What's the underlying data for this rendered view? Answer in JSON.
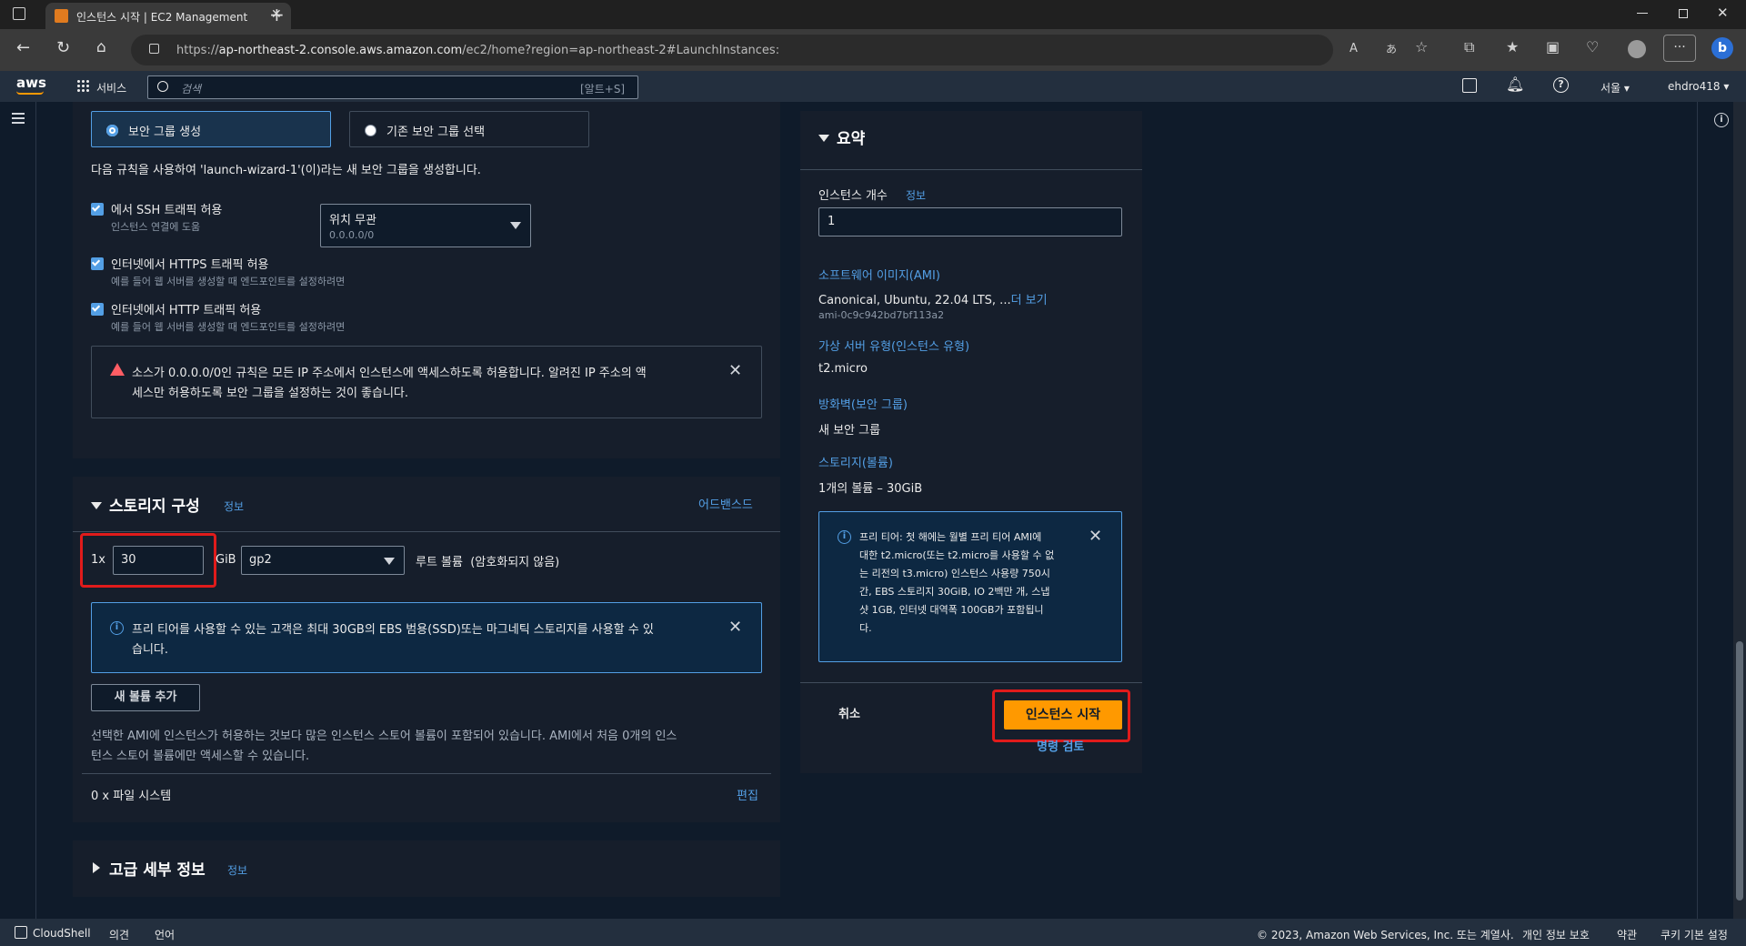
{
  "browser": {
    "tab_title": "인스턴스 시작 | EC2 Management",
    "url_prefix": "https://",
    "url_host": "ap-northeast-2.console.aws.amazon.com",
    "url_path": "/ec2/home?region=ap-northeast-2#LaunchInstances:"
  },
  "aws_nav": {
    "services_label": "서비스",
    "search_placeholder": "검색",
    "search_shortcut": "[알트+S]",
    "region": "서울 ▾",
    "account": "ehdro418 ▾"
  },
  "security_group": {
    "create_option": "보안 그룹 생성",
    "existing_option": "기존 보안 그룹 선택",
    "description": "다음 규칙을 사용하여 'launch-wizard-1'(이)라는 새 보안 그룹을 생성합니다.",
    "ssh_label": "에서 SSH 트래픽 허용",
    "ssh_sub": "인스턴스 연결에 도움",
    "ssh_source_value": "위치 무관",
    "ssh_source_sub": "0.0.0.0/0",
    "https_label": "인터넷에서 HTTPS 트래픽 허용",
    "https_sub": "예를 들어 웹 서버를 생성할 때 엔드포인트를 설정하려면",
    "http_label": "인터넷에서 HTTP 트래픽 허용",
    "http_sub": "예를 들어 웹 서버를 생성할 때 엔드포인트를 설정하려면",
    "warning_line1": "소스가 0.0.0.0/0인 규칙은 모든 IP 주소에서 인스턴스에 액세스하도록 허용합니다. 알려진 IP 주소의 액",
    "warning_line2": "세스만 허용하도록 보안 그룹을 설정하는 것이 좋습니다."
  },
  "storage": {
    "title": "스토리지 구성",
    "info_link": "정보",
    "advanced_link": "어드밴스드",
    "multiplier": "1x",
    "size_value": "30",
    "unit": "GiB",
    "volume_type": "gp2",
    "root_label": "루트 볼륨  (암호화되지 않음)",
    "free_tier_line1": "프리 티어를 사용할 수 있는 고객은 최대 30GB의 EBS 범용(SSD)또는 마그네틱 스토리지를 사용할 수 있",
    "free_tier_line2": "습니다.",
    "add_volume_button": "새 볼륨 추가",
    "store_note_line1": "선택한 AMI에 인스턴스가 허용하는 것보다 많은 인스턴스 스토어 볼륨이 포함되어 있습니다. AMI에서 처음 0개의 인스",
    "store_note_line2": "턴스 스토어 볼륨에만 액세스할 수 있습니다.",
    "filesystems_label": "0 x 파일 시스템",
    "edit_link": "편집"
  },
  "advanced": {
    "title": "고급 세부 정보",
    "info_link": "정보"
  },
  "summary": {
    "title": "요약",
    "instance_count_label": "인스턴스 개수",
    "info_link": "정보",
    "instance_count_value": "1",
    "ami_label": "소프트웨어 이미지(AMI)",
    "ami_value": "Canonical, Ubuntu, 22.04 LTS, ...",
    "ami_more": "더 보기",
    "ami_id": "ami-0c9c942bd7bf113a2",
    "instance_type_label": "가상 서버 유형(인스턴스 유형)",
    "instance_type_value": "t2.micro",
    "firewall_label": "방화벽(보안 그룹)",
    "firewall_value": "새 보안 그룹",
    "storage_label": "스토리지(볼륨)",
    "storage_value": "1개의 볼륨 – 30GiB",
    "free_tier_lines": [
      "프리 티어: 첫 해에는 월별 프리 티어 AMI에",
      "대한 t2.micro(또는 t2.micro를 사용할 수 없",
      "는 리전의 t3.micro) 인스턴스 사용량 750시",
      "간, EBS 스토리지 30GiB, IO 2백만 개, 스냅",
      "샷 1GB, 인터넷 대역폭 100GB가 포함됩니",
      "다."
    ],
    "cancel_button": "취소",
    "launch_button": "인스턴스 시작",
    "review_link": "명령 검토"
  },
  "footer": {
    "cloudshell": "CloudShell",
    "feedback": "의견",
    "language": "언어",
    "copyright": "© 2023, Amazon Web Services, Inc. 또는 계열사.",
    "privacy": "개인 정보 보호",
    "terms": "약관",
    "cookies": "쿠키 기본 설정"
  },
  "colors": {
    "accent": "#539fe5",
    "primary_button": "#ff9900",
    "highlight": "#e01b1b",
    "warning": "#ff5d64"
  }
}
